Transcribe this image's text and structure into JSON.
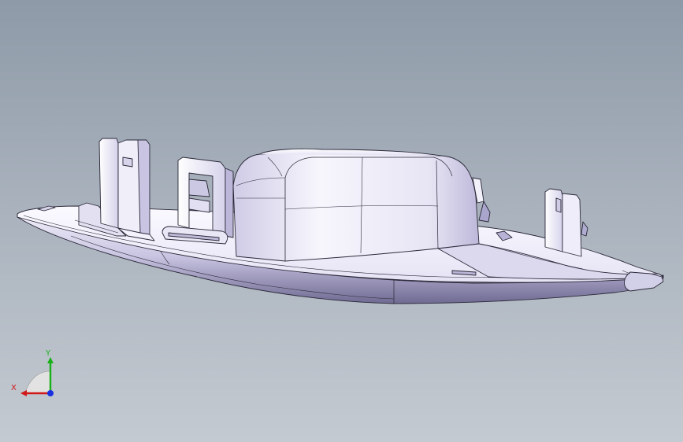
{
  "viewport": {
    "background_top": "#8e9aa8",
    "background_bottom": "#c4cad1"
  },
  "model": {
    "shade_light": "#f4f3fb",
    "shade_mid": "#d9d6ee",
    "shade_dark": "#8c88b0",
    "edge_color": "#2a2838"
  },
  "triad": {
    "x_label": "X",
    "y_label": "Y",
    "x_color": "#d01818",
    "y_color": "#18b018",
    "z_color": "#1830e0",
    "icon": "coordinate-triad-icon"
  }
}
